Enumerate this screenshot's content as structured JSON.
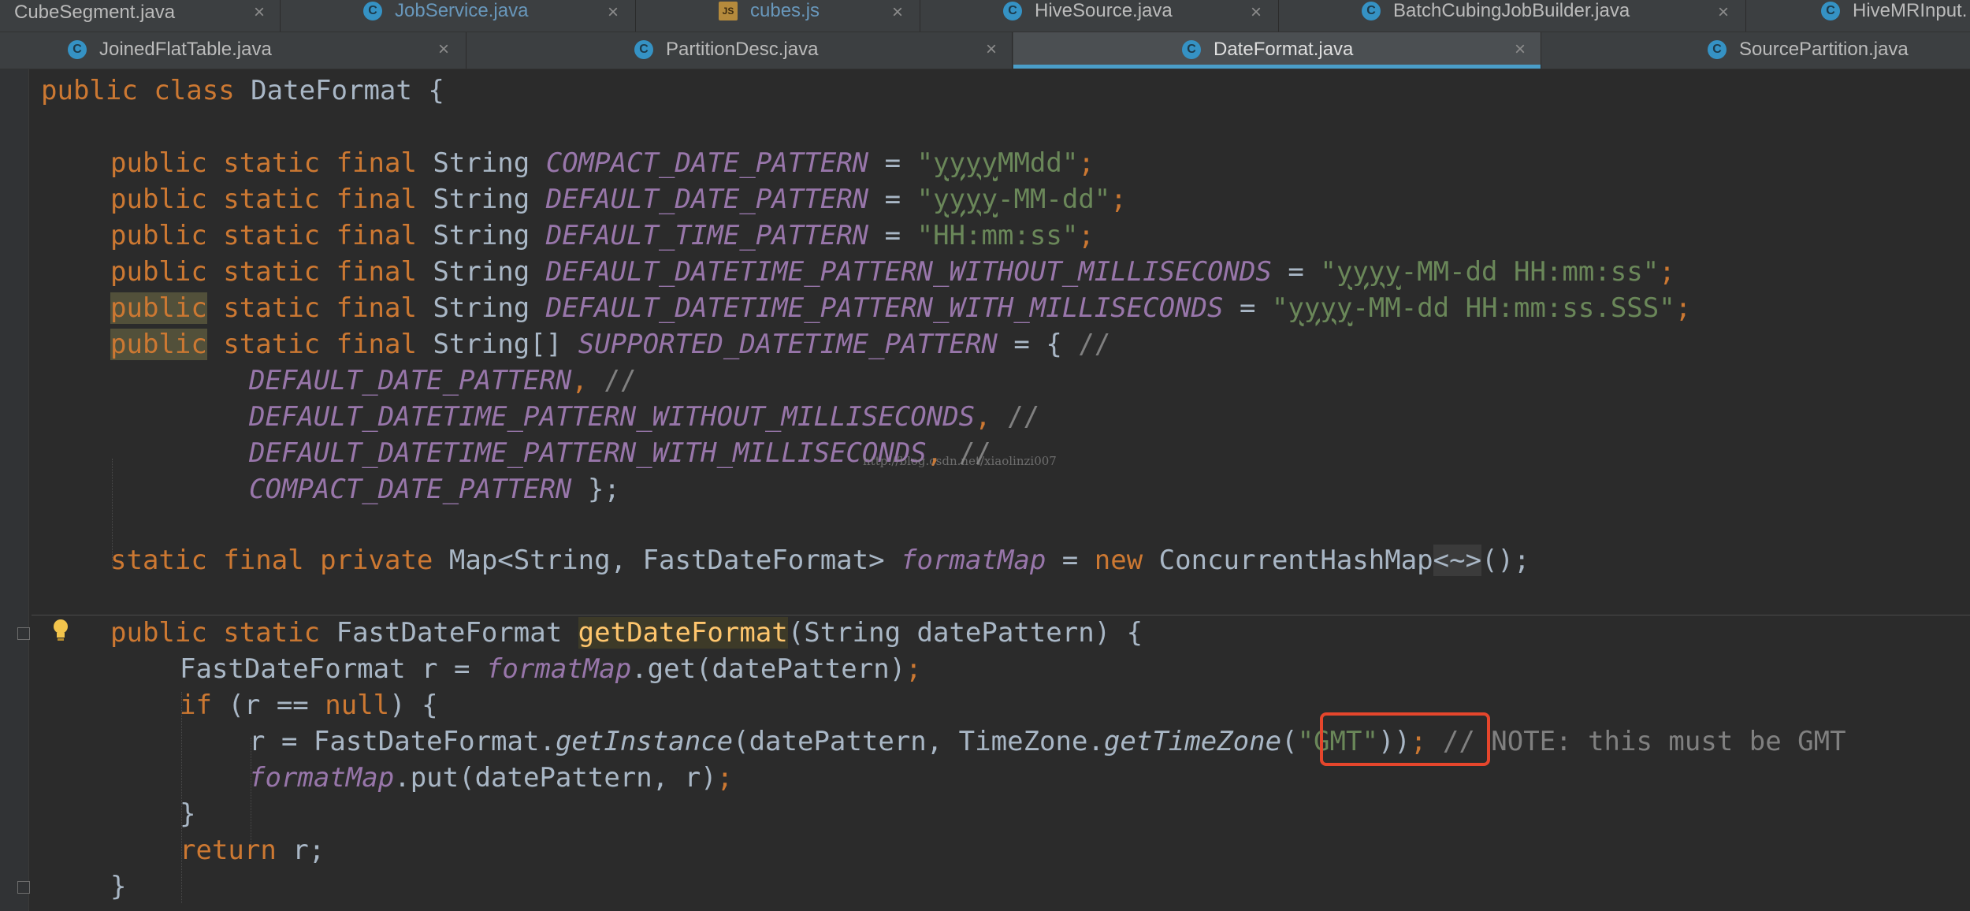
{
  "tabs_row1": [
    {
      "label": "CubeSegment.java",
      "icon": "class-icon"
    },
    {
      "label": "JobService.java",
      "icon": "class-icon"
    },
    {
      "label": "cubes.js",
      "icon": "js-icon"
    },
    {
      "label": "HiveSource.java",
      "icon": "class-icon"
    },
    {
      "label": "BatchCubingJobBuilder.java",
      "icon": "class-icon"
    },
    {
      "label": "HiveMRInput.",
      "icon": "class-icon"
    }
  ],
  "tabs_row2": [
    {
      "label": "JoinedFlatTable.java",
      "icon": "class-icon"
    },
    {
      "label": "PartitionDesc.java",
      "icon": "class-icon"
    },
    {
      "label": "DateFormat.java",
      "icon": "class-icon",
      "active": true
    },
    {
      "label": "SourcePartition.java",
      "icon": "class-icon"
    }
  ],
  "icons": {
    "class_glyph": "C",
    "js_glyph": "JS",
    "close_glyph": "×"
  },
  "code": {
    "l1": {
      "kw1": "public",
      "kw2": "class",
      "name": "DateFormat",
      "brace": "{"
    },
    "l3": {
      "mods": "public static final",
      "type": "String",
      "name": "COMPACT_DATE_PATTERN",
      "eq": "=",
      "q": "\"",
      "sq": "yyyy",
      "rest": "MMdd\"",
      "semi": ";"
    },
    "l4": {
      "mods": "public static final",
      "type": "String",
      "name": "DEFAULT_DATE_PATTERN",
      "eq": "=",
      "q": "\"",
      "sq": "yyyy",
      "rest": "-MM-dd\"",
      "semi": ";"
    },
    "l5": {
      "mods": "public static final",
      "type": "String",
      "name": "DEFAULT_TIME_PATTERN",
      "eq": "=",
      "str": "\"HH:mm:ss\"",
      "semi": ";"
    },
    "l6": {
      "mods": "public static final",
      "type": "String",
      "name": "DEFAULT_DATETIME_PATTERN_WITHOUT_MILLISECONDS",
      "eq": "=",
      "q": "\"",
      "sq": "yyyy",
      "rest": "-MM-dd HH:mm:ss\"",
      "semi": ";"
    },
    "l7": {
      "kw": "public",
      "mods": "static final",
      "type": "String",
      "name": "DEFAULT_DATETIME_PATTERN_WITH_MILLISECONDS",
      "eq": "=",
      "q": "\"",
      "sq": "yyyy",
      "rest": "-MM-dd HH:mm:ss.SSS\"",
      "semi": ";"
    },
    "l8": {
      "kw": "public",
      "mods": "static final",
      "type": "String[]",
      "name": "SUPPORTED_DATETIME_PATTERN",
      "eq": "= {",
      "cmt": "//"
    },
    "l9": {
      "name": "DEFAULT_DATE_PATTERN",
      "comma": ",",
      "cmt": "//"
    },
    "l10": {
      "name": "DEFAULT_DATETIME_PATTERN_WITHOUT_MILLISECONDS",
      "comma": ",",
      "cmt": "//"
    },
    "l11": {
      "name": "DEFAULT_DATETIME_PATTERN_WITH_MILLISECONDS",
      "comma": ",",
      "cmt": "//"
    },
    "l12": {
      "name": "COMPACT_DATE_PATTERN",
      "end": " };"
    },
    "l14": {
      "mods": "static final private",
      "type": "Map<String, FastDateFormat>",
      "name": "formatMap",
      "eq": "=",
      "kwnew": "new",
      "ctor": "ConcurrentHashMap",
      "diamond": "<~>",
      "end": "();"
    },
    "l16": {
      "mods": "public static",
      "type": "FastDateFormat",
      "meth": "getDateFormat",
      "params": "(String datePattern) {"
    },
    "l17": {
      "decl": "FastDateFormat r = ",
      "field": "formatMap",
      "call": ".get(datePattern)",
      "semi": ";"
    },
    "l18": {
      "kw": "if",
      "cond": " (r == ",
      "null": "null",
      "end": ") {"
    },
    "l19": {
      "pre": "r = FastDateFormat.",
      "m1": "getInstance",
      "args": "(datePattern, TimeZone.",
      "m2": "getTimeZone",
      "open": "(",
      "str": "\"GMT\"",
      "close": "))",
      "semi": ";",
      "cmt": " // NOTE: this must be GMT"
    },
    "l20": {
      "field": "formatMap",
      "call": ".put(datePattern, r)",
      "semi": ";"
    },
    "l21": {
      "brace": "}"
    },
    "l22": {
      "kw": "return",
      "rest": " r;"
    },
    "l23": {
      "brace": "}"
    }
  },
  "watermark": "http://blog.csdn.net/xiaolinzi007",
  "colors": {
    "highlight_box": "#e5462c",
    "accent_tab": "#4a9ec9"
  }
}
